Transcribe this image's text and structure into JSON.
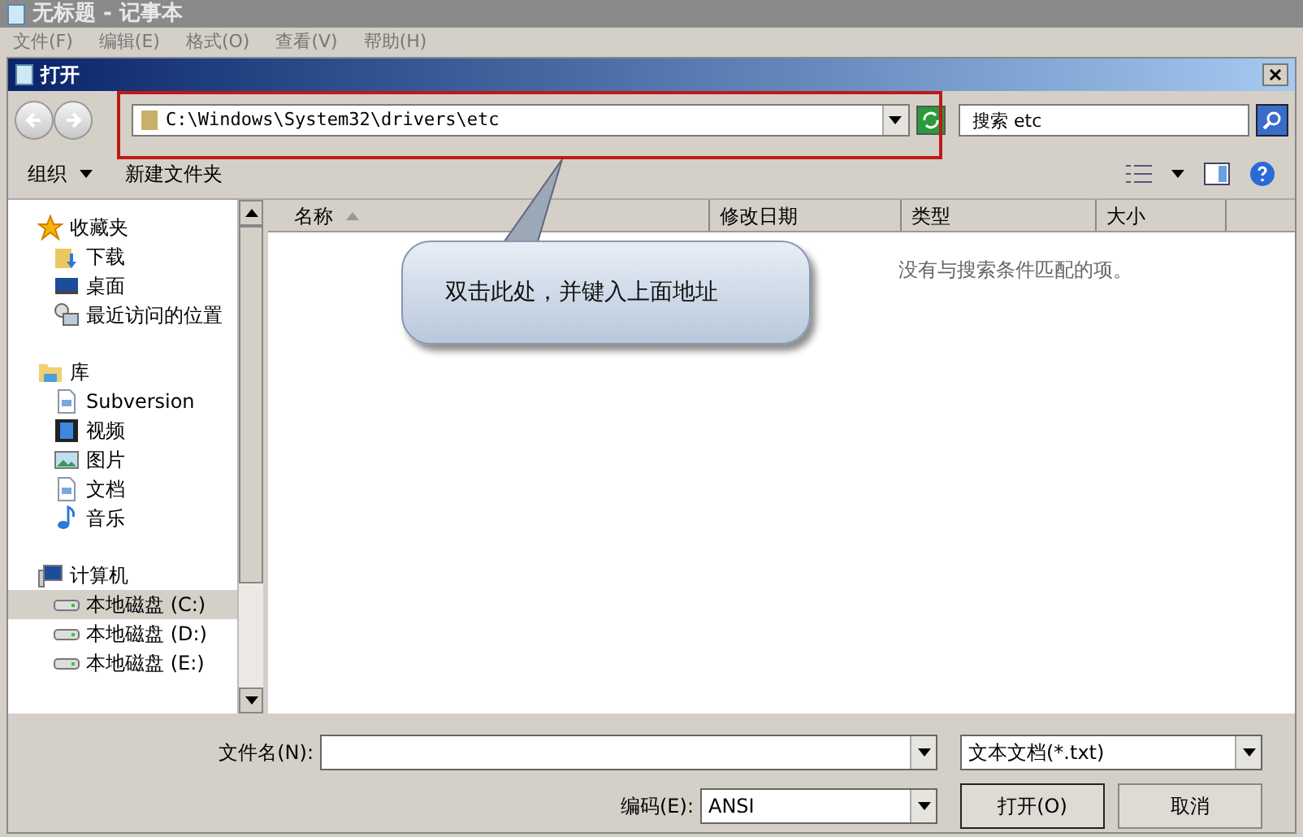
{
  "notepad": {
    "title": "无标题 - 记事本",
    "menu": [
      "文件(F)",
      "编辑(E)",
      "格式(O)",
      "查看(V)",
      "帮助(H)"
    ]
  },
  "dialog": {
    "title": "打开",
    "address": {
      "value": "C:\\Windows\\System32\\drivers\\etc"
    },
    "search": {
      "placeholder": "搜索 etc"
    },
    "toolbar": {
      "organize": "组织",
      "new_folder": "新建文件夹"
    },
    "sidebar": [
      {
        "label": "收藏夹",
        "kind": "star",
        "children": [
          {
            "label": "下载",
            "kind": "download",
            "selected": false
          },
          {
            "label": "桌面",
            "kind": "desktop",
            "selected": false
          },
          {
            "label": "最近访问的位置",
            "kind": "recent",
            "selected": false
          }
        ]
      },
      {
        "label": "库",
        "kind": "library",
        "children": [
          {
            "label": "Subversion",
            "kind": "document",
            "selected": false
          },
          {
            "label": "视频",
            "kind": "video",
            "selected": false
          },
          {
            "label": "图片",
            "kind": "picture",
            "selected": false
          },
          {
            "label": "文档",
            "kind": "document",
            "selected": false
          },
          {
            "label": "音乐",
            "kind": "music",
            "selected": false
          }
        ]
      },
      {
        "label": "计算机",
        "kind": "computer",
        "children": [
          {
            "label": "本地磁盘 (C:)",
            "kind": "drive",
            "selected": true
          },
          {
            "label": "本地磁盘 (D:)",
            "kind": "drive",
            "selected": false
          },
          {
            "label": "本地磁盘 (E:)",
            "kind": "drive",
            "selected": false
          }
        ]
      }
    ],
    "columns": [
      {
        "label": "名称",
        "sorted": true
      },
      {
        "label": "修改日期",
        "sorted": false
      },
      {
        "label": "类型",
        "sorted": false
      },
      {
        "label": "大小",
        "sorted": false
      }
    ],
    "empty_message": "没有与搜索条件匹配的项。",
    "filename": {
      "label": "文件名(N):"
    },
    "filetype": {
      "value": "文本文档(*.txt)"
    },
    "encoding": {
      "label": "编码(E):",
      "value": "ANSI"
    },
    "buttons": [
      "打开(O)",
      "取消"
    ]
  },
  "annotation": {
    "text": "双击此处，并键入上面地址"
  }
}
